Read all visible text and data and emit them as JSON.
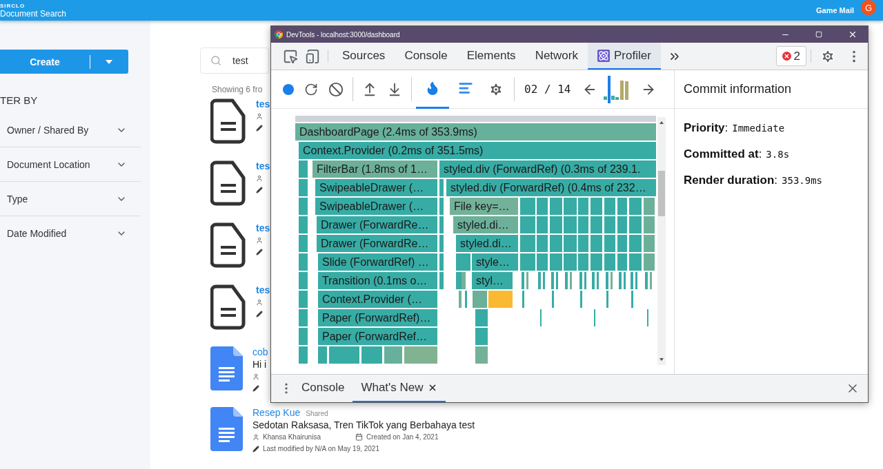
{
  "header": {
    "brand": "SIRCLO",
    "title": "Document Search",
    "user_name": "Game Mail",
    "avatar_initial": "G"
  },
  "sidebar": {
    "create_button": "Create",
    "filter_heading": "TER BY",
    "filters": [
      {
        "label": "Owner / Shared By",
        "expanded": false
      },
      {
        "label": "Document Location",
        "expanded": false
      },
      {
        "label": "Type",
        "expanded": false
      },
      {
        "label": "Date Modified",
        "expanded": false
      }
    ]
  },
  "search": {
    "value": "test"
  },
  "results_summary": "Showing 6 fro",
  "results": [
    {
      "kind": "file",
      "title": "tes"
    },
    {
      "kind": "file",
      "title": "tes"
    },
    {
      "kind": "file",
      "title": "tes"
    },
    {
      "kind": "file",
      "title": "tes"
    },
    {
      "kind": "gdoc",
      "title": "cob",
      "excerpt": "Hi i"
    },
    {
      "kind": "gdoc",
      "title": "Resep Kue",
      "badge": "Shared",
      "excerpt": "Sedotan Raksasa, Tren TikTok yang Berbahaya test",
      "owner": "Khansa Khairunisa",
      "created": "Created on Jan 4, 2021",
      "modified": "Last modified by N/A on May 19, 2021"
    }
  ],
  "devtools": {
    "title": "DevTools - localhost:3000/dashboard",
    "tabs": [
      {
        "label": "Sources",
        "kind": "panel",
        "selected": false
      },
      {
        "label": "Console",
        "kind": "panel",
        "selected": false
      },
      {
        "label": "Elements",
        "kind": "panel",
        "selected": false
      },
      {
        "label": "Network",
        "kind": "panel",
        "selected": false
      },
      {
        "label": "Profiler",
        "kind": "extension",
        "selected": true
      }
    ],
    "error_count": "2",
    "profiler": {
      "views": [
        {
          "selected": true
        },
        {
          "selected": false
        }
      ],
      "commit_counter": "02 / 14",
      "flame_bars": [
        {
          "label": "DashboardPage (2.4ms of 353.9ms)",
          "color": "#67b09c"
        },
        {
          "label": "Context.Provider (0.2ms of 351.5ms)",
          "color": "#37aca5"
        },
        {
          "label": "FilterBar (1.8ms of 1…",
          "color": "#6cb09a"
        },
        {
          "label": "styled.div (ForwardRef) (0.3ms of 239.1.",
          "color": "#37aca5"
        },
        {
          "label": "SwipeableDrawer (…",
          "color": "#37aca5"
        },
        {
          "label": "styled.div (ForwardRef) (0.4ms of 232…",
          "color": "#37aca5"
        },
        {
          "label": "SwipeableDrawer (…",
          "color": "#37aca5"
        },
        {
          "label": "File key=…",
          "color": "#74b199"
        },
        {
          "label": "Drawer (ForwardRe…",
          "color": "#37aca5"
        },
        {
          "label": "styled.di…",
          "color": "#6cb09a"
        },
        {
          "label": "Drawer (ForwardRe…",
          "color": "#37aca5"
        },
        {
          "label": "styled.di…",
          "color": "#37aca5"
        },
        {
          "label": "Slide (ForwardRef) …",
          "color": "#37aca5"
        },
        {
          "label": "style…",
          "color": "#37aca5"
        },
        {
          "label": "Transition (0.1ms o…",
          "color": "#37aca5"
        },
        {
          "label": "styl…",
          "color": "#37aca5"
        },
        {
          "label": "Context.Provider (…",
          "color": "#37aca5"
        },
        {
          "label": "Paper (ForwardRef)…",
          "color": "#37aca5"
        },
        {
          "label": "Paper (ForwardRef…",
          "color": "#37aca5"
        }
      ],
      "commit_info": {
        "title": "Commit information",
        "details": [
          {
            "label": "**Priority**:",
            "value": "Immediate"
          },
          {
            "label": "**Committed at**:",
            "value": "3.8s"
          },
          {
            "label": "**Render duration**:",
            "value": "353.9ms"
          }
        ]
      }
    },
    "drawer_tabs": [
      {
        "label": "Console",
        "selected": false,
        "closable": false
      },
      {
        "label": "What's New",
        "selected": true,
        "closable": true
      }
    ]
  }
}
